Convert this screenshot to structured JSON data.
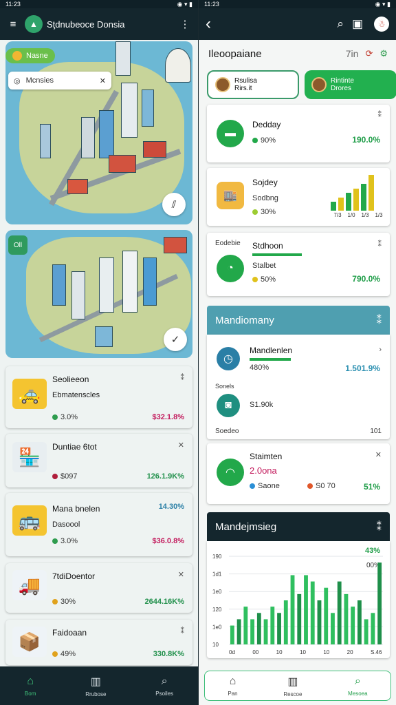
{
  "left": {
    "status": {
      "time": "11:23",
      "icons": "◉ ▾ ▮"
    },
    "header": {
      "title": "Sţdnubeoce Donsia",
      "menu_icon": "≡",
      "more_icon": "⋮"
    },
    "chip": {
      "label": "Nasne"
    },
    "search": {
      "placeholder": "Mcnsies"
    },
    "map1_button": "⫽",
    "map2_badge": "Oll",
    "map2_button": "✓",
    "cards": [
      {
        "title": "Seolieeon",
        "subtitle": "Ebmatenscles",
        "pct": "3.0%",
        "value": "$32.1.8%",
        "value_color": "#c2185b",
        "bg": "linear-gradient(90deg,#ffffff 40%,#d7f4f7)",
        "dot": "#2e9c4e",
        "emoji": "🚕"
      },
      {
        "title": "Duntiae 6tot",
        "subtitle": "",
        "pct": "$097",
        "value": "126.1.9K%",
        "value_color": "#1f8f4a",
        "bg": "linear-gradient(90deg,#e2f8fb,#c8f0f4)",
        "dot": "#b01e3c",
        "emoji": "🏪"
      },
      {
        "title": "Mana bnelen",
        "subtitle": "Dasoool",
        "pct": "3.0%",
        "value": "$36.0.8%",
        "value_top": "14.30%",
        "value_color": "#c2185b",
        "bg": "linear-gradient(90deg,#ffffff 60%,#fdf6e4)",
        "dot": "#2e9c4e",
        "emoji": "🚌"
      },
      {
        "title": "7tdiDoentor",
        "subtitle": "",
        "pct": "30%",
        "value": "2644.16K%",
        "value_color": "#1f8f4a",
        "bg": "linear-gradient(90deg,#f1f8e4,#e3f2d0)",
        "dot": "#e0a21c",
        "emoji": "🚚"
      },
      {
        "title": "Faidoaan",
        "subtitle": "",
        "pct": "49%",
        "value": "330.8K%",
        "value_color": "#1f8f4a",
        "bg": "linear-gradient(90deg,#eaf7fb,#d9f1f8)",
        "dot": "#e0a21c",
        "emoji": "📦"
      }
    ],
    "nav": [
      {
        "label": "Bom",
        "icon": "⌂",
        "active": true
      },
      {
        "label": "Rrubose",
        "icon": "▥",
        "active": false
      },
      {
        "label": "Psoiles",
        "icon": "⌕",
        "active": false
      }
    ]
  },
  "right": {
    "status": {
      "time": "11:23",
      "icons": "◉ ▾ ▮"
    },
    "header": {
      "back_icon": "‹",
      "search_icon": "⌕",
      "bookmark_icon": "▣",
      "profile_icon": "☃"
    },
    "title": "Ileoopaiane",
    "title_side": "7in",
    "pills": [
      {
        "line1": "Rsulisa",
        "line2": "Rirs.it",
        "active": false
      },
      {
        "line1": "Rintinte",
        "line2": "Drores",
        "active": true
      }
    ],
    "card1": {
      "title": "Dedday",
      "pct": "90%",
      "value": "190.0%"
    },
    "card2": {
      "title": "Sojdey",
      "subtitle": "Sodbng",
      "pct": "30%",
      "axis": [
        "7/3",
        "1/0",
        "1/3",
        "1/3"
      ],
      "bars": [
        2,
        3,
        4,
        5,
        6,
        8
      ]
    },
    "card3": {
      "side": "Eodebie",
      "title": "Stdhoon",
      "subtitle": "Stalbet",
      "pct": "50%",
      "value": "790.0%"
    },
    "section1": {
      "title": "Mandiomany",
      "icon": "⁑"
    },
    "card4": {
      "title": "Mandlenlen",
      "pct": "480%",
      "value": "1.501.9%",
      "side": "Sonels",
      "item": "S1.90k",
      "footer_left": "Soedeo",
      "footer_right": "101"
    },
    "card5": {
      "title": "Staimten",
      "num": "2.0ona",
      "leg1": "Saone",
      "leg2": "S0 70",
      "value": "51%"
    },
    "section2": {
      "title": "Mandejmsieg",
      "icon": "⁑"
    },
    "chart_data": {
      "type": "bar",
      "title": "Mandejmsieg",
      "xlabel": "",
      "ylabel": "",
      "y_ticks": [
        "190",
        "1d1",
        "1e0",
        "120",
        "1e0",
        "10"
      ],
      "x_ticks": [
        "0d",
        "00",
        "10",
        "10",
        "10",
        "20",
        "S.46"
      ],
      "values": [
        3,
        4,
        6,
        4,
        5,
        4,
        6,
        5,
        7,
        11,
        8,
        11,
        10,
        7,
        9,
        5,
        10,
        8,
        6,
        7,
        4,
        5,
        13
      ],
      "top_value": "43%",
      "second_value": "00%"
    },
    "nav": [
      {
        "label": "Pan",
        "icon": "⌂",
        "active": false
      },
      {
        "label": "Rescoe",
        "icon": "▥",
        "active": false
      },
      {
        "label": "Mesoea",
        "icon": "⌕",
        "active": true
      }
    ]
  }
}
